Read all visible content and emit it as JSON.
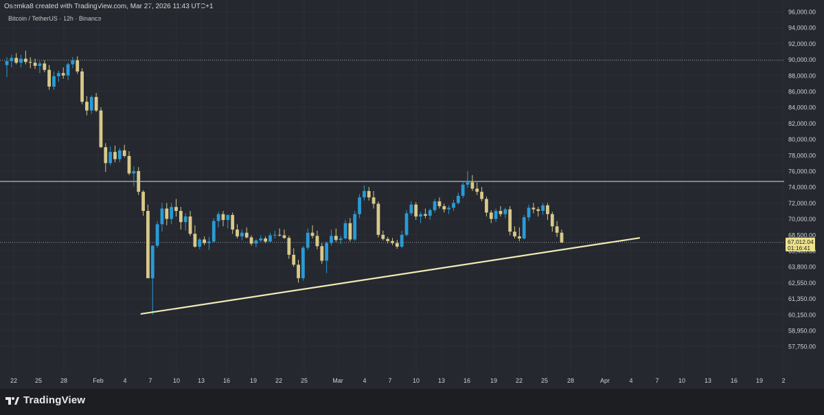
{
  "header": {
    "credit": "Osemka8 created with TradingView.com, Mar 27, 2026 11:43 UTC+1",
    "symbol": "Bitcoin / TetherUS · 12h · Binance"
  },
  "footer": {
    "brand": "TradingView"
  },
  "colors": {
    "background": "#25282e",
    "bull": "#2a9ad6",
    "bear": "#d8c98a",
    "trendline": "#f0ecb6",
    "price_label_bg": "#eee48e"
  },
  "chart_data": {
    "type": "candlestick",
    "timeframe": "12h",
    "y_axis_labels": [
      "96,000.00",
      "94,000.00",
      "92,000.00",
      "90,000.00",
      "88,000.00",
      "86,000.00",
      "84,000.00",
      "82,000.00",
      "80,000.00",
      "78,000.00",
      "76,000.00",
      "74,000.00",
      "72,000.00",
      "70,000.00",
      "68,500.00",
      "65,400.00",
      "63,800.00",
      "62,550.00",
      "61,350.00",
      "60,150.00",
      "58,950.00",
      "57,750.00"
    ],
    "x_axis_labels": [
      "22",
      "25",
      "28",
      "Feb",
      "4",
      "7",
      "10",
      "13",
      "16",
      "19",
      "22",
      "25",
      "Mar",
      "4",
      "7",
      "10",
      "13",
      "16",
      "19",
      "22",
      "25",
      "28",
      "Apr",
      "4",
      "7",
      "10",
      "13",
      "16",
      "19",
      "2"
    ],
    "current_price": "67,012.04",
    "countdown": "01:16:41",
    "horizontal_levels": [
      89900,
      74700,
      67012
    ],
    "trendline": {
      "from": {
        "date": "Feb 6",
        "price": 60200
      },
      "to": {
        "date": "Apr 4",
        "price": 67900
      }
    },
    "candles": [
      [
        89300,
        90300,
        87800,
        89800
      ],
      [
        89800,
        90600,
        89000,
        90200
      ],
      [
        90200,
        90800,
        89400,
        89600
      ],
      [
        89600,
        90600,
        89000,
        90100
      ],
      [
        90100,
        91100,
        89400,
        89700
      ],
      [
        89700,
        90300,
        88900,
        89600
      ],
      [
        89600,
        90100,
        88800,
        89200
      ],
      [
        89200,
        89800,
        88300,
        89500
      ],
      [
        89500,
        89900,
        88400,
        88700
      ],
      [
        88700,
        89300,
        86200,
        86600
      ],
      [
        86600,
        88500,
        86200,
        87900
      ],
      [
        87900,
        88600,
        87200,
        88300
      ],
      [
        88300,
        89000,
        87600,
        88000
      ],
      [
        88000,
        89600,
        87400,
        89400
      ],
      [
        89400,
        90300,
        88900,
        89900
      ],
      [
        89900,
        90400,
        88200,
        88500
      ],
      [
        88500,
        88900,
        84400,
        84700
      ],
      [
        84700,
        85400,
        83000,
        83600
      ],
      [
        83600,
        85500,
        83200,
        85300
      ],
      [
        85300,
        85800,
        83400,
        83600
      ],
      [
        83600,
        84000,
        78900,
        79000
      ],
      [
        79000,
        79500,
        75900,
        77000
      ],
      [
        77000,
        79100,
        76700,
        78400
      ],
      [
        78400,
        79200,
        77100,
        77500
      ],
      [
        77500,
        78900,
        77100,
        78600
      ],
      [
        78600,
        79300,
        77700,
        77900
      ],
      [
        77900,
        78500,
        75500,
        75700
      ],
      [
        75700,
        76600,
        74100,
        76000
      ],
      [
        76000,
        76500,
        73000,
        73400
      ],
      [
        73400,
        73600,
        70400,
        71000
      ],
      [
        71000,
        71800,
        64000,
        62900
      ],
      [
        62900,
        66500,
        60150,
        66400
      ],
      [
        66400,
        69800,
        66000,
        69500
      ],
      [
        69500,
        72000,
        68800,
        71300
      ],
      [
        71300,
        72000,
        69400,
        70000
      ],
      [
        70000,
        72000,
        69500,
        71500
      ],
      [
        71500,
        72500,
        70300,
        71000
      ],
      [
        71000,
        71500,
        69000,
        69700
      ],
      [
        69700,
        70700,
        68900,
        70300
      ],
      [
        70300,
        71000,
        68300,
        68600
      ],
      [
        68600,
        69400,
        66000,
        66200
      ],
      [
        66200,
        67900,
        65700,
        67600
      ],
      [
        67600,
        68200,
        66500,
        66900
      ],
      [
        66900,
        68100,
        65600,
        67200
      ],
      [
        67200,
        70100,
        67000,
        69800
      ],
      [
        69800,
        70900,
        69200,
        70600
      ],
      [
        70600,
        71000,
        69300,
        69900
      ],
      [
        69900,
        70500,
        69100,
        70500
      ],
      [
        70500,
        70800,
        68600,
        69000
      ],
      [
        69000,
        69500,
        67800,
        68200
      ],
      [
        68200,
        69000,
        67500,
        68700
      ],
      [
        68700,
        69200,
        67800,
        68000
      ],
      [
        68000,
        68400,
        66400,
        66800
      ],
      [
        66800,
        67700,
        66100,
        67400
      ],
      [
        67400,
        68400,
        67100,
        67800
      ],
      [
        67800,
        68200,
        66900,
        67200
      ],
      [
        67200,
        68700,
        67000,
        68400
      ],
      [
        68400,
        68900,
        67800,
        68500
      ],
      [
        68500,
        69100,
        68200,
        68400
      ],
      [
        68400,
        69000,
        67700,
        67900
      ],
      [
        67900,
        68300,
        64600,
        65000
      ],
      [
        65000,
        65900,
        63800,
        64000
      ],
      [
        64000,
        64500,
        62550,
        62900
      ],
      [
        62900,
        66300,
        62700,
        66000
      ],
      [
        66000,
        69100,
        65600,
        68700
      ],
      [
        68700,
        69400,
        67800,
        68300
      ],
      [
        68300,
        68900,
        65700,
        66300
      ],
      [
        66300,
        66900,
        64100,
        64400
      ],
      [
        64400,
        67200,
        63300,
        66900
      ],
      [
        66900,
        69000,
        66400,
        68300
      ],
      [
        68300,
        69100,
        67100,
        67500
      ],
      [
        67500,
        68300,
        66700,
        67800
      ],
      [
        67800,
        69900,
        67600,
        69600
      ],
      [
        69600,
        70100,
        67200,
        67600
      ],
      [
        67600,
        71000,
        67300,
        70600
      ],
      [
        70600,
        73100,
        70100,
        72700
      ],
      [
        72700,
        74200,
        72300,
        73500
      ],
      [
        73500,
        74000,
        72300,
        72700
      ],
      [
        72700,
        73500,
        71300,
        71900
      ],
      [
        71900,
        72200,
        68000,
        68500
      ],
      [
        68500,
        68900,
        67400,
        67700
      ],
      [
        67700,
        68100,
        66800,
        67300
      ],
      [
        67300,
        67900,
        66500,
        66900
      ],
      [
        66900,
        67500,
        65800,
        66200
      ],
      [
        66200,
        68900,
        65900,
        68500
      ],
      [
        68500,
        71100,
        68200,
        70700
      ],
      [
        70700,
        72200,
        70400,
        71800
      ],
      [
        71800,
        72100,
        69900,
        70300
      ],
      [
        70300,
        70900,
        69600,
        70600
      ],
      [
        70600,
        71300,
        70100,
        70400
      ],
      [
        70400,
        71300,
        69900,
        71100
      ],
      [
        71100,
        72500,
        70800,
        72200
      ],
      [
        72200,
        72700,
        71300,
        71600
      ],
      [
        71600,
        71900,
        70800,
        71200
      ],
      [
        71200,
        71700,
        70600,
        71400
      ],
      [
        71400,
        72400,
        71000,
        72000
      ],
      [
        72000,
        73300,
        71800,
        72900
      ],
      [
        72900,
        74600,
        72600,
        74300
      ],
      [
        74300,
        76000,
        73900,
        74600
      ],
      [
        74600,
        75500,
        73500,
        73800
      ],
      [
        73800,
        74600,
        73000,
        73400
      ],
      [
        73400,
        74000,
        72200,
        72500
      ],
      [
        72500,
        72800,
        70300,
        70800
      ],
      [
        70800,
        71100,
        69600,
        70000
      ],
      [
        70000,
        71300,
        69700,
        71000
      ],
      [
        71000,
        71600,
        70300,
        70600
      ],
      [
        70600,
        71400,
        70100,
        71200
      ],
      [
        71200,
        71600,
        68400,
        68800
      ],
      [
        68800,
        69300,
        67800,
        68200
      ],
      [
        68200,
        69200,
        67300,
        67800
      ],
      [
        67800,
        70500,
        67600,
        70200
      ],
      [
        70200,
        71800,
        69800,
        71400
      ],
      [
        71400,
        72000,
        70700,
        71200
      ],
      [
        71200,
        71500,
        70300,
        71000
      ],
      [
        71000,
        72000,
        70500,
        71700
      ],
      [
        71700,
        72000,
        69900,
        70600
      ],
      [
        70600,
        70900,
        68800,
        69300
      ],
      [
        69300,
        69800,
        68100,
        68700
      ],
      [
        68700,
        69000,
        66900,
        67012
      ]
    ]
  }
}
